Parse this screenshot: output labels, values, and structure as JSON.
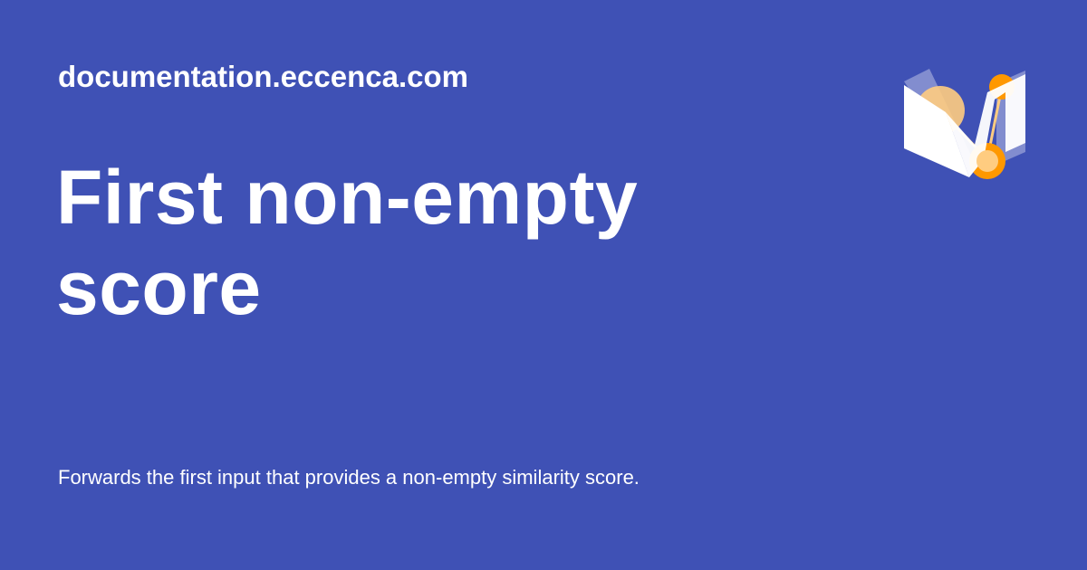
{
  "site": {
    "name": "documentation.eccenca.com"
  },
  "page": {
    "title": "First non-empty score",
    "description": "Forwards the first input that provides a non-empty similarity score."
  },
  "logo": {
    "icon": "eccenca-logo-icon"
  },
  "colors": {
    "background": "#3f51b5",
    "text": "#ffffff",
    "accent_orange": "#ff9800",
    "accent_light_orange": "#ffcc80"
  }
}
